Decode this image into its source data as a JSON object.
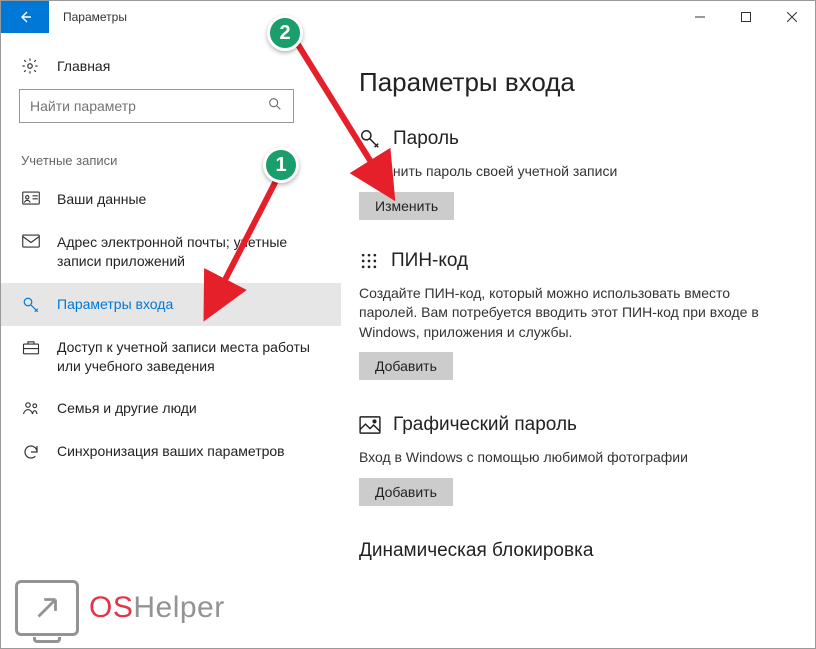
{
  "window": {
    "title": "Параметры"
  },
  "sidebar": {
    "home": "Главная",
    "search_placeholder": "Найти параметр",
    "section": "Учетные записи",
    "items": [
      {
        "label": "Ваши данные"
      },
      {
        "label": "Адрес электронной почты; учетные записи приложений"
      },
      {
        "label": "Параметры входа"
      },
      {
        "label": "Доступ к учетной записи места работы или учебного заведения"
      },
      {
        "label": "Семья и другие люди"
      },
      {
        "label": "Синхронизация ваших параметров"
      }
    ]
  },
  "main": {
    "heading": "Параметры входа",
    "password": {
      "title": "Пароль",
      "desc": "Изменить пароль своей учетной записи",
      "btn": "Изменить"
    },
    "pin": {
      "title": "ПИН-код",
      "desc": "Создайте ПИН-код, который можно использовать вместо паролей. Вам потребуется вводить этот ПИН-код при входе в Windows, приложения и службы.",
      "btn": "Добавить"
    },
    "picture": {
      "title": "Графический пароль",
      "desc": "Вход в Windows с помощью любимой фотографии",
      "btn": "Добавить"
    },
    "dynamic": {
      "title": "Динамическая блокировка"
    }
  },
  "markers": {
    "one": "1",
    "two": "2"
  },
  "watermark": {
    "os": "OS",
    "helper": "Helper"
  }
}
